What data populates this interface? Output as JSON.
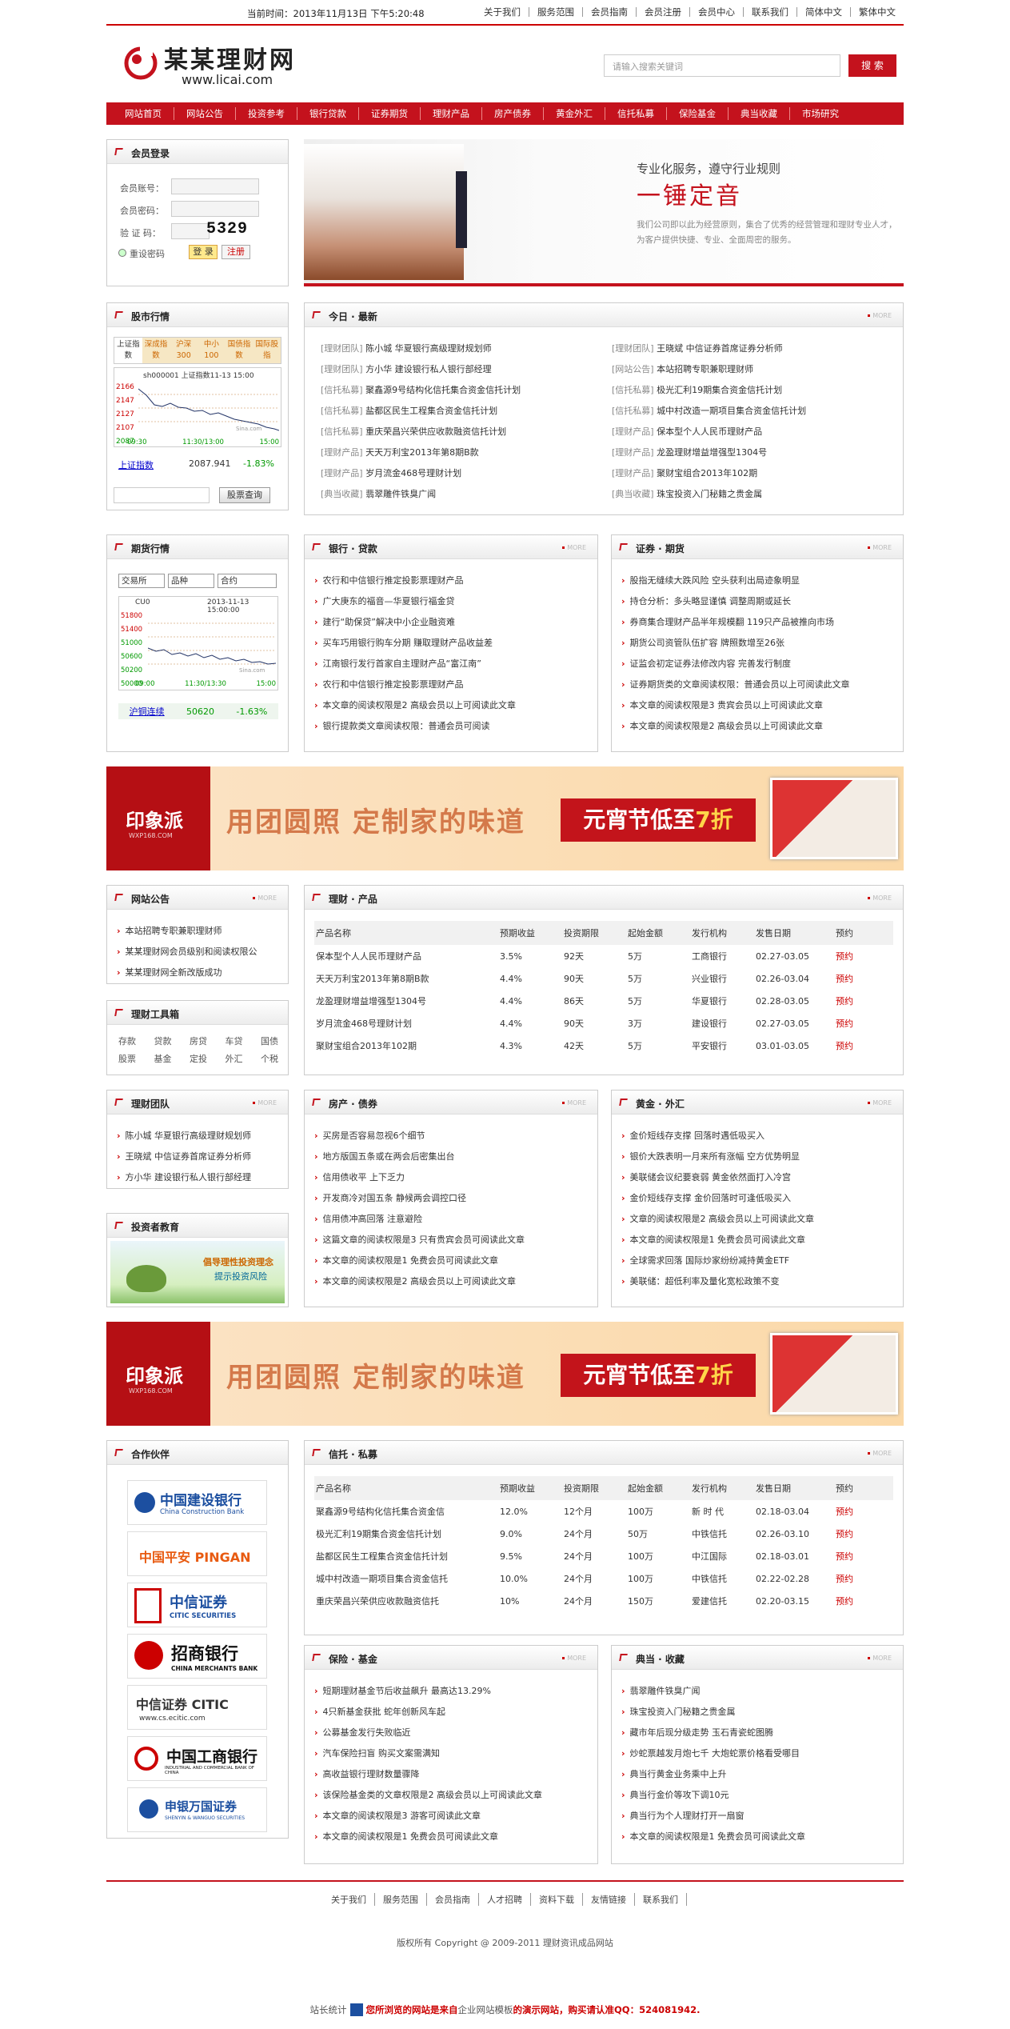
{
  "topbar": {
    "now": "当前时间：2013年11月13日 下午5:20:48",
    "links": [
      "关于我们",
      "服务范围",
      "会员指南",
      "会员注册",
      "会员中心",
      "联系我们",
      "简体中文",
      "繁体中文"
    ]
  },
  "header": {
    "logo_title": "某某理财网",
    "logo_url": "www.licai.com",
    "search_placeholder": "请输入搜索关键词",
    "search_button": "搜 索"
  },
  "nav": [
    "网站首页",
    "网站公告",
    "投资参考",
    "银行贷款",
    "证券期货",
    "理财产品",
    "房产债券",
    "黄金外汇",
    "信托私募",
    "保险基金",
    "典当收藏",
    "市场研究"
  ],
  "login": {
    "title": "会员登录",
    "account": "会员账号：",
    "password": "会员密码：",
    "captcha_label": "验 证 码：",
    "captcha": "5329",
    "reset": "重设密码",
    "login_btn": "登 录",
    "register_btn": "注册"
  },
  "hero": {
    "tagline": "专业化服务，遵守行业规则",
    "headline": "一锤定音",
    "body": "我们公司即以此为经营原则，集合了优秀的经营管理和理财专业人才，为客户提供快捷、专业、全面周密的服务。"
  },
  "stock": {
    "title": "股市行情",
    "tabs": [
      "上证指数",
      "深成指数",
      "沪深300",
      "中小100",
      "国债指数",
      "国际股指"
    ],
    "chart_title": "sh000001 上证指数11-13 15:00",
    "y_ticks": [
      "2166",
      "2147",
      "2127",
      "2107",
      "2087"
    ],
    "x_ticks": [
      "09:30",
      "11:30/13:00",
      "15:00"
    ],
    "watermark": "Sina.com",
    "name": "上证指数",
    "value": "2087.941",
    "change": "-1.83%",
    "query_btn": "股票查询"
  },
  "news": {
    "title": "今日 · 最新",
    "more": "MORE",
    "left": [
      [
        "[理财团队]",
        "陈小城 华夏银行高级理财规划师"
      ],
      [
        "[理财团队]",
        "方小华 建设银行私人银行部经理"
      ],
      [
        "[信托私募]",
        "聚鑫源9号结构化信托集合资金信托计划"
      ],
      [
        "[信托私募]",
        "盐都区民生工程集合资金信托计划"
      ],
      [
        "[信托私募]",
        "重庆荣昌兴荣供应收款融资信托计划"
      ],
      [
        "[理财产品]",
        "天天万利宝2013年第8期B款"
      ],
      [
        "[理财产品]",
        "岁月流金468号理财计划"
      ],
      [
        "[典当收藏]",
        "翡翠雕件铁臭广闻"
      ]
    ],
    "right": [
      [
        "[理财团队]",
        "王晓斌 中信证券首席证券分析师"
      ],
      [
        "[网站公告]",
        "本站招聘专职兼职理财师"
      ],
      [
        "[信托私募]",
        "极光汇利19期集合资金信托计划"
      ],
      [
        "[信托私募]",
        "城中村改造一期项目集合资金信托计划"
      ],
      [
        "[理财产品]",
        "保本型个人人民币理财产品"
      ],
      [
        "[理财产品]",
        "龙盈理财增益增强型1304号"
      ],
      [
        "[理财产品]",
        "聚财宝组合2013年102期"
      ],
      [
        "[典当收藏]",
        "珠宝投资入门秘籍之贵金属"
      ]
    ]
  },
  "futures": {
    "title": "期货行情",
    "selects": [
      "交易所",
      "品种",
      "合约"
    ],
    "chart_title": "CU0",
    "chart_time": "2013-11-13 15:00:00",
    "y_ticks": [
      "51800",
      "51400",
      "51000",
      "50600",
      "50200",
      "50000"
    ],
    "x_ticks": [
      "09:00",
      "11:30/13:30",
      "15:00"
    ],
    "watermark": "Sina.com",
    "name": "沪铜连续",
    "value": "50620",
    "change": "-1.63%"
  },
  "bank": {
    "title": "银行 · 贷款",
    "items": [
      "农行和中信银行推定投影票理财产品",
      "广大庚东的福音—华夏银行福金贷",
      "建行“助保贷”解决中小企业融资难",
      "买车巧用银行购车分期 赚取理财产品收益差",
      "江南银行发行首家自主理财产品“富江南”",
      "农行和中信银行推定投影票理财产品",
      "本文章的阅读权限是2 高级会员以上可阅读此文章",
      "银行提款类文章阅读权限：普通会员可阅读"
    ]
  },
  "securities": {
    "title": "证券 · 期货",
    "items": [
      "股指无缝续大跌风险 空头获利出局迹象明显",
      "持仓分析：多头略显谨慎 调整周期或延长",
      "券商集合理财产品半年规模翻 119只产品被推向市场",
      "期货公司资管队伍扩容 牌照数增至26张",
      "证监会初定证券法修改内容 完善发行制度",
      "证券期货类的文章阅读权限：普通会员以上可阅读此文章",
      "本文章的阅读权限是3 贵宾会员以上可阅读此文章",
      "本文章的阅读权限是2 高级会员以上可阅读此文章"
    ]
  },
  "banner": {
    "logo": "印象派",
    "logo_sub": "WXP168.COM",
    "slogan": "用团圆照 定制家的味道",
    "promo_a": "元宵节低至",
    "promo_b": "7折"
  },
  "notice": {
    "title": "网站公告",
    "items": [
      "本站招聘专职兼职理财师",
      "某某理财网会员级别和阅读权限公",
      "某某理财网全新改版成功"
    ]
  },
  "tools": {
    "title": "理财工具箱",
    "row1": [
      "存款",
      "贷款",
      "房贷",
      "车贷",
      "国债"
    ],
    "row2": [
      "股票",
      "基金",
      "定投",
      "外汇",
      "个税"
    ]
  },
  "products": {
    "title": "理财 · 产品",
    "headers": [
      "产品名称",
      "预期收益",
      "投资期限",
      "起始金额",
      "发行机构",
      "发售日期",
      "预约"
    ],
    "rows": [
      [
        "保本型个人人民币理财产品",
        "3.5%",
        "92天",
        "5万",
        "工商银行",
        "02.27-03.05",
        "预约"
      ],
      [
        "天天万利宝2013年第8期B款",
        "4.4%",
        "90天",
        "5万",
        "兴业银行",
        "02.26-03.04",
        "预约"
      ],
      [
        "龙盈理财增益增强型1304号",
        "4.4%",
        "86天",
        "5万",
        "华夏银行",
        "02.28-03.05",
        "预约"
      ],
      [
        "岁月流金468号理财计划",
        "4.4%",
        "90天",
        "3万",
        "建设银行",
        "02.27-03.05",
        "预约"
      ],
      [
        "聚财宝组合2013年102期",
        "4.3%",
        "42天",
        "5万",
        "平安银行",
        "03.01-03.05",
        "预约"
      ]
    ]
  },
  "team": {
    "title": "理财团队",
    "items": [
      "陈小城 华夏银行高级理财规划师",
      "王晓斌 中信证券首席证券分析师",
      "方小华 建设银行私人银行部经理"
    ]
  },
  "edu": {
    "title": "投资者教育",
    "line1": "倡导理性投资理念",
    "line2": "提示投资风险"
  },
  "realestate": {
    "title": "房产 · 债券",
    "items": [
      "买房是否容易忽视6个细节",
      "地方版国五条或在两会后密集出台",
      "信用债收平 上下乏力",
      "开发商冷对国五条 静候两会调控口径",
      "信用债冲高回落 注意避险",
      "这篇文章的阅读权限是3 只有贵宾会员可阅读此文章",
      "本文章的阅读权限是1 免费会员可阅读此文章",
      "本文章的阅读权限是2 高级会员以上可阅读此文章"
    ]
  },
  "gold": {
    "title": "黄金 · 外汇",
    "items": [
      "金价短线存支撑 回落时遇低吸买入",
      "银价大跌表明一月来所有涨幅 空方优势明显",
      "美联储会议纪要衰弱 黄金依然面打入冷宫",
      "金价短线存支撑 金价回落时可逢低吸买入",
      "文章的阅读权限是2 高级会员以上可阅读此文章",
      "本文章的阅读权限是1 免费会员可阅读此文章",
      "全球需求回落 国际炒家纷纷减持黄金ETF",
      "美联储：超低利率及量化宽松政策不变"
    ]
  },
  "partners": {
    "title": "合作伙伴",
    "logos": [
      {
        "cn": "中国建设银行",
        "en": "China Construction Bank",
        "color": "#1c4fa0"
      },
      {
        "cn": "中国平安 PINGAN",
        "en": "",
        "color": "#e85a10"
      },
      {
        "cn": "中信证券",
        "en": "CITIC SECURITIES",
        "color": "#1c4fa0"
      },
      {
        "cn": "招商银行",
        "en": "CHINA MERCHANTS BANK",
        "color": "#c00"
      },
      {
        "cn": "中信证券 CITIC",
        "en": "www.cs.ecitic.com",
        "color": "#c00"
      },
      {
        "cn": "中国工商银行",
        "en": "INDUSTRIAL AND COMMERCIAL BANK OF CHINA",
        "color": "#c00"
      },
      {
        "cn": "申银万国证券",
        "en": "SHENYIN & WANGUO SECURITIES",
        "color": "#1c4fa0"
      }
    ]
  },
  "trust": {
    "title": "信托 · 私募",
    "headers": [
      "产品名称",
      "预期收益",
      "投资期限",
      "起始金额",
      "发行机构",
      "发售日期",
      "预约"
    ],
    "rows": [
      [
        "聚鑫源9号结构化信托集合资金信",
        "12.0%",
        "12个月",
        "100万",
        "新 时 代",
        "02.18-03.04",
        "预约"
      ],
      [
        "极光汇利19期集合资金信托计划",
        "9.0%",
        "24个月",
        "50万",
        "中铁信托",
        "02.26-03.10",
        "预约"
      ],
      [
        "盐都区民生工程集合资金信托计划",
        "9.5%",
        "24个月",
        "100万",
        "中江国际",
        "02.18-03.01",
        "预约"
      ],
      [
        "城中村改造一期项目集合资金信托",
        "10.0%",
        "24个月",
        "100万",
        "中铁信托",
        "02.22-02.28",
        "预约"
      ],
      [
        "重庆荣昌兴荣供应收款融资信托",
        "10%",
        "24个月",
        "150万",
        "爱建信托",
        "02.20-03.15",
        "预约"
      ]
    ]
  },
  "insurance": {
    "title": "保险 · 基金",
    "items": [
      "短期理财基金节后收益飙升 最高达13.29%",
      "4只新基金获批 蛇年创新风车起",
      "公募基金发行失败临近",
      "汽车保险扫盲 购买文案需满知",
      "高收益银行理财数量骤降",
      "该保险基金类的文章权限是2 高级会员以上可阅读此文章",
      "本文章的阅读权限是3 游客可阅读此文章",
      "本文章的阅读权限是1 免费会员可阅读此文章"
    ]
  },
  "pawn": {
    "title": "典当 · 收藏",
    "items": [
      "翡翠雕件铁臭广闻",
      "珠宝投资入门秘籍之贵金属",
      "藏市年后现分级走势 玉石青瓷蛇图腾",
      "炒蛇票越发月炮七千 大炮蛇票价格看受哪目",
      "典当行黄金业务乘中上升",
      "典当行金价等攻下调10元",
      "典当行为个人理财打开一扇窗",
      "本文章的阅读权限是1 免费会员可阅读此文章"
    ]
  },
  "footer": {
    "links": [
      "关于我们",
      "服务范围",
      "会员指南",
      "人才招聘",
      "资料下载",
      "友情链接",
      "联系我们"
    ],
    "copyright": "版权所有 Copyright @ 2009-2011 理财资讯成品网站",
    "stat": "站长统计",
    "notice_a": "您所浏览的网站是来自",
    "notice_b": "企业网站模板",
    "notice_c": "的演示网站，购买请认准QQ：524081942."
  },
  "colors": {
    "brand_red": "#c4121d",
    "up": "#c00",
    "down": "#090"
  }
}
